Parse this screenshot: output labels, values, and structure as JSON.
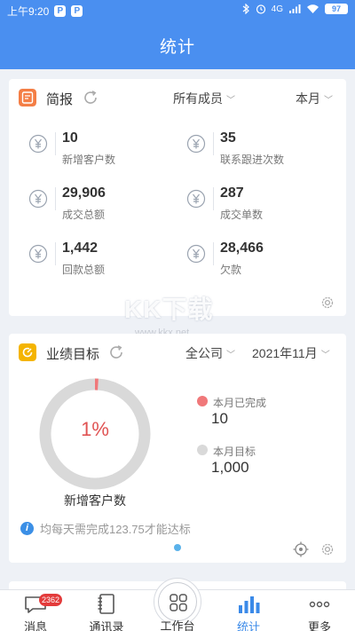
{
  "status_bar": {
    "time": "上午9:20",
    "app_icons": [
      "P",
      "P"
    ],
    "network": "4G",
    "battery": "97"
  },
  "header": {
    "title": "统计"
  },
  "brief": {
    "title": "简报",
    "icon": "report-icon",
    "filter_member": "所有成员",
    "filter_period": "本月",
    "stats": [
      {
        "value": "10",
        "label": "新增客户数"
      },
      {
        "value": "35",
        "label": "联系跟进次数"
      },
      {
        "value": "29,906",
        "label": "成交总额"
      },
      {
        "value": "287",
        "label": "成交单数"
      },
      {
        "value": "1,442",
        "label": "回款总额"
      },
      {
        "value": "28,466",
        "label": "欠款"
      }
    ]
  },
  "watermark": {
    "text": "KK下载",
    "url": "www.kkx.net"
  },
  "goal": {
    "title": "业绩目标",
    "icon": "target-icon",
    "filter_scope": "全公司",
    "filter_month": "2021年11月",
    "percent_text": "1%",
    "progress": 0.01,
    "chart_label": "新增客户数",
    "completed_label": "本月已完成",
    "completed_value": "10",
    "target_label": "本月目标",
    "target_value": "1,000",
    "tip": "均每天需完成123.75才能达标",
    "colors": {
      "done": "#f0787a",
      "track": "#d9d9d9"
    }
  },
  "tabbar": {
    "tabs": [
      {
        "label": "消息",
        "icon": "message-icon",
        "badge": "2362"
      },
      {
        "label": "通讯录",
        "icon": "contacts-icon"
      },
      {
        "label": "工作台",
        "icon": "workbench-icon"
      },
      {
        "label": "统计",
        "icon": "stats-icon",
        "active": true
      },
      {
        "label": "更多",
        "icon": "more-icon"
      }
    ]
  }
}
